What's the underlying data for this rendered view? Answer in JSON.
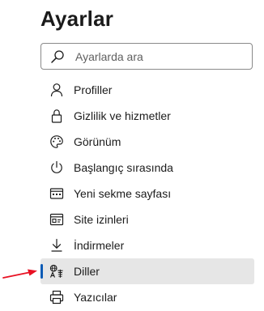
{
  "page": {
    "title": "Ayarlar"
  },
  "search": {
    "placeholder": "Ayarlarda ara",
    "value": "",
    "icon": "search-icon"
  },
  "nav": {
    "selected": "Diller",
    "items": [
      {
        "label": "Profiller",
        "icon": "person-icon"
      },
      {
        "label": "Gizlilik ve hizmetler",
        "icon": "lock-icon"
      },
      {
        "label": "Görünüm",
        "icon": "palette-icon"
      },
      {
        "label": "Başlangıç sırasında",
        "icon": "power-icon"
      },
      {
        "label": "Yeni sekme sayfası",
        "icon": "new-tab-page-icon"
      },
      {
        "label": "Site izinleri",
        "icon": "site-permissions-icon"
      },
      {
        "label": "İndirmeler",
        "icon": "download-icon"
      },
      {
        "label": "Diller",
        "icon": "languages-icon"
      },
      {
        "label": "Yazıcılar",
        "icon": "printer-icon"
      }
    ]
  },
  "colors": {
    "selected_background": "#e6e6e6",
    "selected_indicator": "#0b5bb5",
    "annotation_arrow": "#e81123"
  }
}
